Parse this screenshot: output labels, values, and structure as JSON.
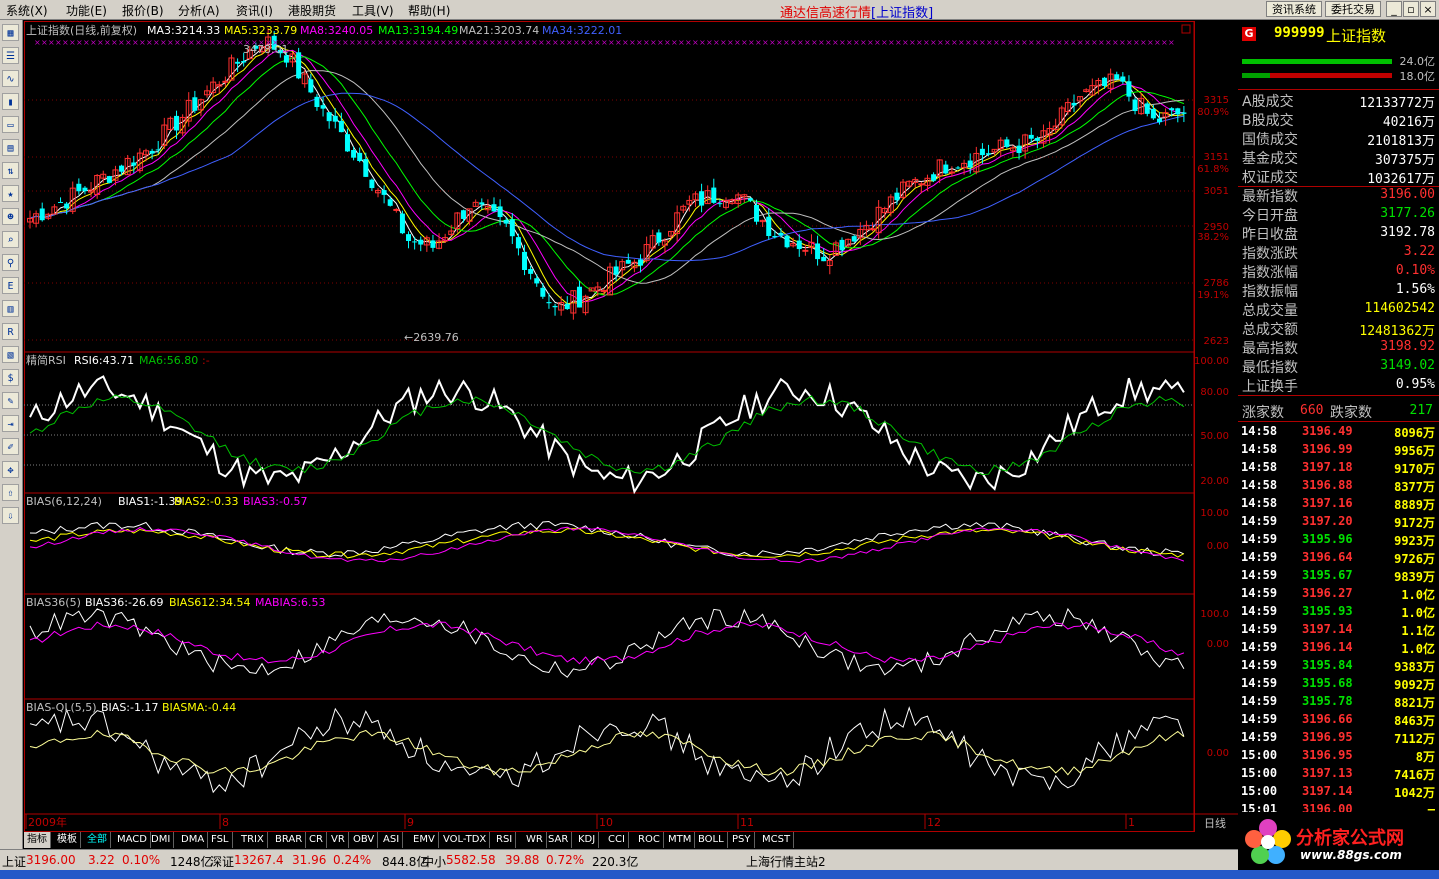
{
  "menu": [
    "系统(X)",
    "功能(E)",
    "报价(B)",
    "分析(A)",
    "资讯(I)",
    "港股期货",
    "工具(V)",
    "帮助(H)"
  ],
  "app_title": "通达信高速行情",
  "app_title_suffix": "[上证指数]",
  "window_buttons": [
    "资讯系统",
    "委托交易"
  ],
  "toolbar_icons": [
    "grid-icon",
    "list-icon",
    "line-chart-icon",
    "candle-icon",
    "window-icon",
    "table-icon",
    "sort-icon",
    "star-icon",
    "people-icon",
    "search-icon",
    "zoom-icon",
    "etf-icon",
    "bars-icon",
    "rsi-icon",
    "report-icon",
    "money-icon",
    "tools-icon",
    "exit-icon",
    "pencil-icon",
    "move-icon",
    "arrow-up-icon",
    "arrow-down-icon"
  ],
  "main_chart": {
    "header": "上证指数(日线,前复权)",
    "ma3": "MA3:3214.33",
    "ma5": "MA5:3233.79",
    "ma8": "MA8:3240.05",
    "ma13": "MA13:3194.49",
    "ma21": "MA21:3203.74",
    "ma34": "MA34:3222.01",
    "high_label": "3478.01",
    "low_label": "←2639.76",
    "y_labels": [
      "3315",
      "80.9%",
      "3151",
      "61.8%",
      "3051",
      "2950",
      "38.2%",
      "2786",
      "19.1%",
      "2623"
    ]
  },
  "rsi_panel": {
    "header": "精简RSI",
    "rsi6": "RSI6:43.71",
    "ma6": "MA6:56.80",
    "marker": ":-",
    "y_labels": [
      "100.00",
      "80.00",
      "50.00",
      "20.00"
    ]
  },
  "bias_panel": {
    "header": "BIAS(6,12,24)",
    "bias1": "BIAS1:-1.39",
    "bias2": "BIAS2:-0.33",
    "bias3": "BIAS3:-0.57",
    "y_labels": [
      "10.00",
      "0.00"
    ]
  },
  "bias36_panel": {
    "header": "BIAS36(5)",
    "bias36": "BIAS36:-26.69",
    "bias612": "BIAS612:34.54",
    "mabias": "MABIAS:6.53",
    "y_labels": [
      "100.0",
      "0.00"
    ]
  },
  "biasql_panel": {
    "header": "BIAS-QL(5,5)",
    "bias": "BIAS:-1.17",
    "biasma": "BIASMA:-0.44",
    "y_labels": [
      "0.00"
    ]
  },
  "x_axis": {
    "labels": [
      "2009年",
      "8",
      "9",
      "10",
      "11",
      "12",
      "1"
    ],
    "period": "日线"
  },
  "tabs": [
    "指标",
    "模板",
    "全部",
    "MACD",
    "DMI",
    "DMA",
    "FSL",
    "TRIX",
    "BRAR",
    "CR",
    "VR",
    "OBV",
    "ASI",
    "EMV",
    "VOL-TDX",
    "RSI",
    "WR",
    "SAR",
    "KDJ",
    "CCI",
    "ROC",
    "MTM",
    "BOLL",
    "PSY",
    "MCST"
  ],
  "quote": {
    "code": "999999",
    "name": "上证指数",
    "badge": "G",
    "bar1_value": "24.0亿",
    "bar2_value": "18.0亿",
    "rows": [
      {
        "label": "A股成交",
        "value": "12133772万",
        "color": "#ffffff"
      },
      {
        "label": "B股成交",
        "value": "40216万",
        "color": "#ffffff"
      },
      {
        "label": "国债成交",
        "value": "2101813万",
        "color": "#ffffff"
      },
      {
        "label": "基金成交",
        "value": "307375万",
        "color": "#ffffff"
      },
      {
        "label": "权证成交",
        "value": "1032617万",
        "color": "#ffffff"
      },
      {
        "label": "最新指数",
        "value": "3196.00",
        "color": "#ff3030"
      },
      {
        "label": "今日开盘",
        "value": "3177.26",
        "color": "#00e000"
      },
      {
        "label": "昨日收盘",
        "value": "3192.78",
        "color": "#ffffff"
      },
      {
        "label": "指数涨跌",
        "value": "3.22",
        "color": "#ff3030"
      },
      {
        "label": "指数涨幅",
        "value": "0.10%",
        "color": "#ff3030"
      },
      {
        "label": "指数振幅",
        "value": "1.56%",
        "color": "#ffffff"
      },
      {
        "label": "总成交量",
        "value": "114602542",
        "color": "#ffff00"
      },
      {
        "label": "总成交额",
        "value": "12481362万",
        "color": "#ffff00"
      },
      {
        "label": "最高指数",
        "value": "3198.92",
        "color": "#ff3030"
      },
      {
        "label": "最低指数",
        "value": "3149.02",
        "color": "#00e000"
      },
      {
        "label": "上证换手",
        "value": "0.95%",
        "color": "#ffffff"
      }
    ],
    "up_label": "涨家数",
    "up_count": "660",
    "down_label": "跌家数",
    "down_count": "217",
    "ticks": [
      [
        "14:58",
        "3196.49",
        "8096万"
      ],
      [
        "14:58",
        "3196.99",
        "9956万"
      ],
      [
        "14:58",
        "3197.18",
        "9170万"
      ],
      [
        "14:58",
        "3196.88",
        "8377万"
      ],
      [
        "14:58",
        "3197.16",
        "8889万"
      ],
      [
        "14:59",
        "3197.20",
        "9172万"
      ],
      [
        "14:59",
        "3195.96",
        "9923万"
      ],
      [
        "14:59",
        "3196.64",
        "9726万"
      ],
      [
        "14:59",
        "3195.67",
        "9839万"
      ],
      [
        "14:59",
        "3196.27",
        "1.0亿"
      ],
      [
        "14:59",
        "3195.93",
        "1.0亿"
      ],
      [
        "14:59",
        "3197.14",
        "1.1亿"
      ],
      [
        "14:59",
        "3196.14",
        "1.0亿"
      ],
      [
        "14:59",
        "3195.84",
        "9383万"
      ],
      [
        "14:59",
        "3195.68",
        "9092万"
      ],
      [
        "14:59",
        "3195.78",
        "8821万"
      ],
      [
        "14:59",
        "3196.66",
        "8463万"
      ],
      [
        "14:59",
        "3196.95",
        "7112万"
      ],
      [
        "15:00",
        "3196.95",
        "8万"
      ],
      [
        "15:00",
        "3197.13",
        "7416万"
      ],
      [
        "15:00",
        "3197.14",
        "1042万"
      ],
      [
        "15:01",
        "3196.00",
        "—"
      ]
    ]
  },
  "status": {
    "sh_label": "上证",
    "sh_value": "3196.00",
    "sh_change": "3.22",
    "sh_pct": "0.10%",
    "sh_amount": "1248亿",
    "sz_label": "深证",
    "sz_value": "13267.4",
    "sz_change": "31.96",
    "sz_pct": "0.24%",
    "sz_amount": "844.8亿",
    "zx_label": "中小",
    "zx_value": "5582.58",
    "zx_change": "39.88",
    "zx_pct": "0.72%",
    "zx_amount": "220.3亿",
    "server": "上海行情主站2"
  },
  "logo": {
    "text": "分析家公式网",
    "url": "www.88gs.com"
  },
  "colors": {
    "up": "#ff3030",
    "down": "#00ffff",
    "ma3": "#ffffff",
    "ma5": "#ffff00",
    "ma8": "#ff00ff",
    "ma13": "#00ff00",
    "ma21": "#c0c0c0",
    "ma34": "#4060ff"
  }
}
